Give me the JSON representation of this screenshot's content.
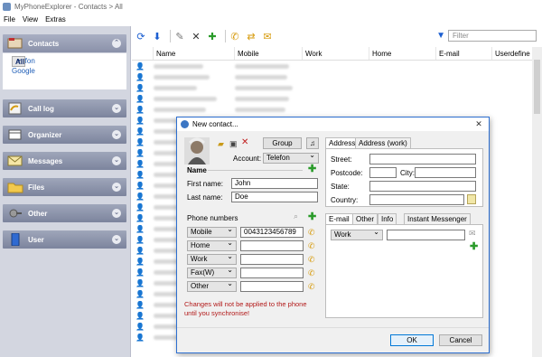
{
  "window": {
    "title": "MyPhoneExplorer - Contacts > All"
  },
  "menu": [
    "File",
    "View",
    "Extras"
  ],
  "sidebar": {
    "groups": [
      {
        "label": "Contacts",
        "icon": "contacts-icon"
      },
      {
        "label": "Call log",
        "icon": "call-log-icon"
      },
      {
        "label": "Organizer",
        "icon": "organizer-icon"
      },
      {
        "label": "Messages",
        "icon": "messages-icon"
      },
      {
        "label": "Files",
        "icon": "files-icon"
      },
      {
        "label": "Other",
        "icon": "other-icon"
      },
      {
        "label": "User",
        "icon": "user-icon"
      }
    ],
    "contact_filters": [
      "All",
      "Telefon",
      "Google"
    ]
  },
  "toolbar": {
    "filter_placeholder": "Filter"
  },
  "grid": {
    "columns": [
      "Name",
      "Mobile",
      "Work",
      "Home",
      "E-mail",
      "Userdefine"
    ]
  },
  "dialog": {
    "title": "New contact...",
    "group_button": "Group",
    "account_label": "Account:",
    "account_value": "Telefon",
    "name_section": "Name",
    "first_name_label": "First name:",
    "first_name_value": "John",
    "last_name_label": "Last name:",
    "last_name_value": "Doe",
    "phone_section": "Phone numbers",
    "phones": [
      {
        "type": "Mobile",
        "value": "0043123456789"
      },
      {
        "type": "Home",
        "value": ""
      },
      {
        "type": "Work",
        "value": ""
      },
      {
        "type": "Fax(W)",
        "value": ""
      },
      {
        "type": "Other",
        "value": ""
      }
    ],
    "warning": "Changes will not be applied to the phone until you synchronise!",
    "address_tabs": [
      "Address",
      "Address (work)"
    ],
    "address_fields": {
      "street": "Street:",
      "postcode": "Postcode:",
      "city": "City:",
      "state": "State:",
      "country": "Country:"
    },
    "info_tabs": [
      "E-mail",
      "Other",
      "Info",
      "Instant Messenger"
    ],
    "email_type": "Work",
    "ok_button": "OK",
    "cancel_button": "Cancel"
  }
}
